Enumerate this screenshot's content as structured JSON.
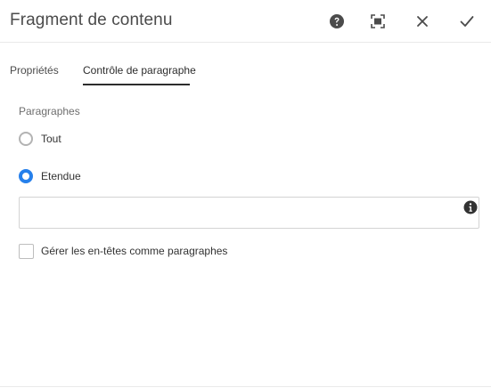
{
  "header": {
    "title": "Fragment de contenu",
    "icons": [
      "help-icon",
      "fullscreen-icon",
      "close-icon",
      "confirm-icon"
    ]
  },
  "tabs": [
    {
      "label": "Propriétés",
      "active": false
    },
    {
      "label": "Contrôle de paragraphe",
      "active": true
    }
  ],
  "form": {
    "section_label": "Paragraphes",
    "radios": [
      {
        "label": "Tout",
        "checked": false
      },
      {
        "label": "Etendue",
        "checked": true
      }
    ],
    "range_input": {
      "value": "",
      "placeholder": ""
    },
    "checkbox": {
      "label": "Gérer les en-têtes comme paragraphes",
      "checked": false
    }
  },
  "colors": {
    "accent": "#2680eb",
    "icon": "#4b4b4b"
  }
}
